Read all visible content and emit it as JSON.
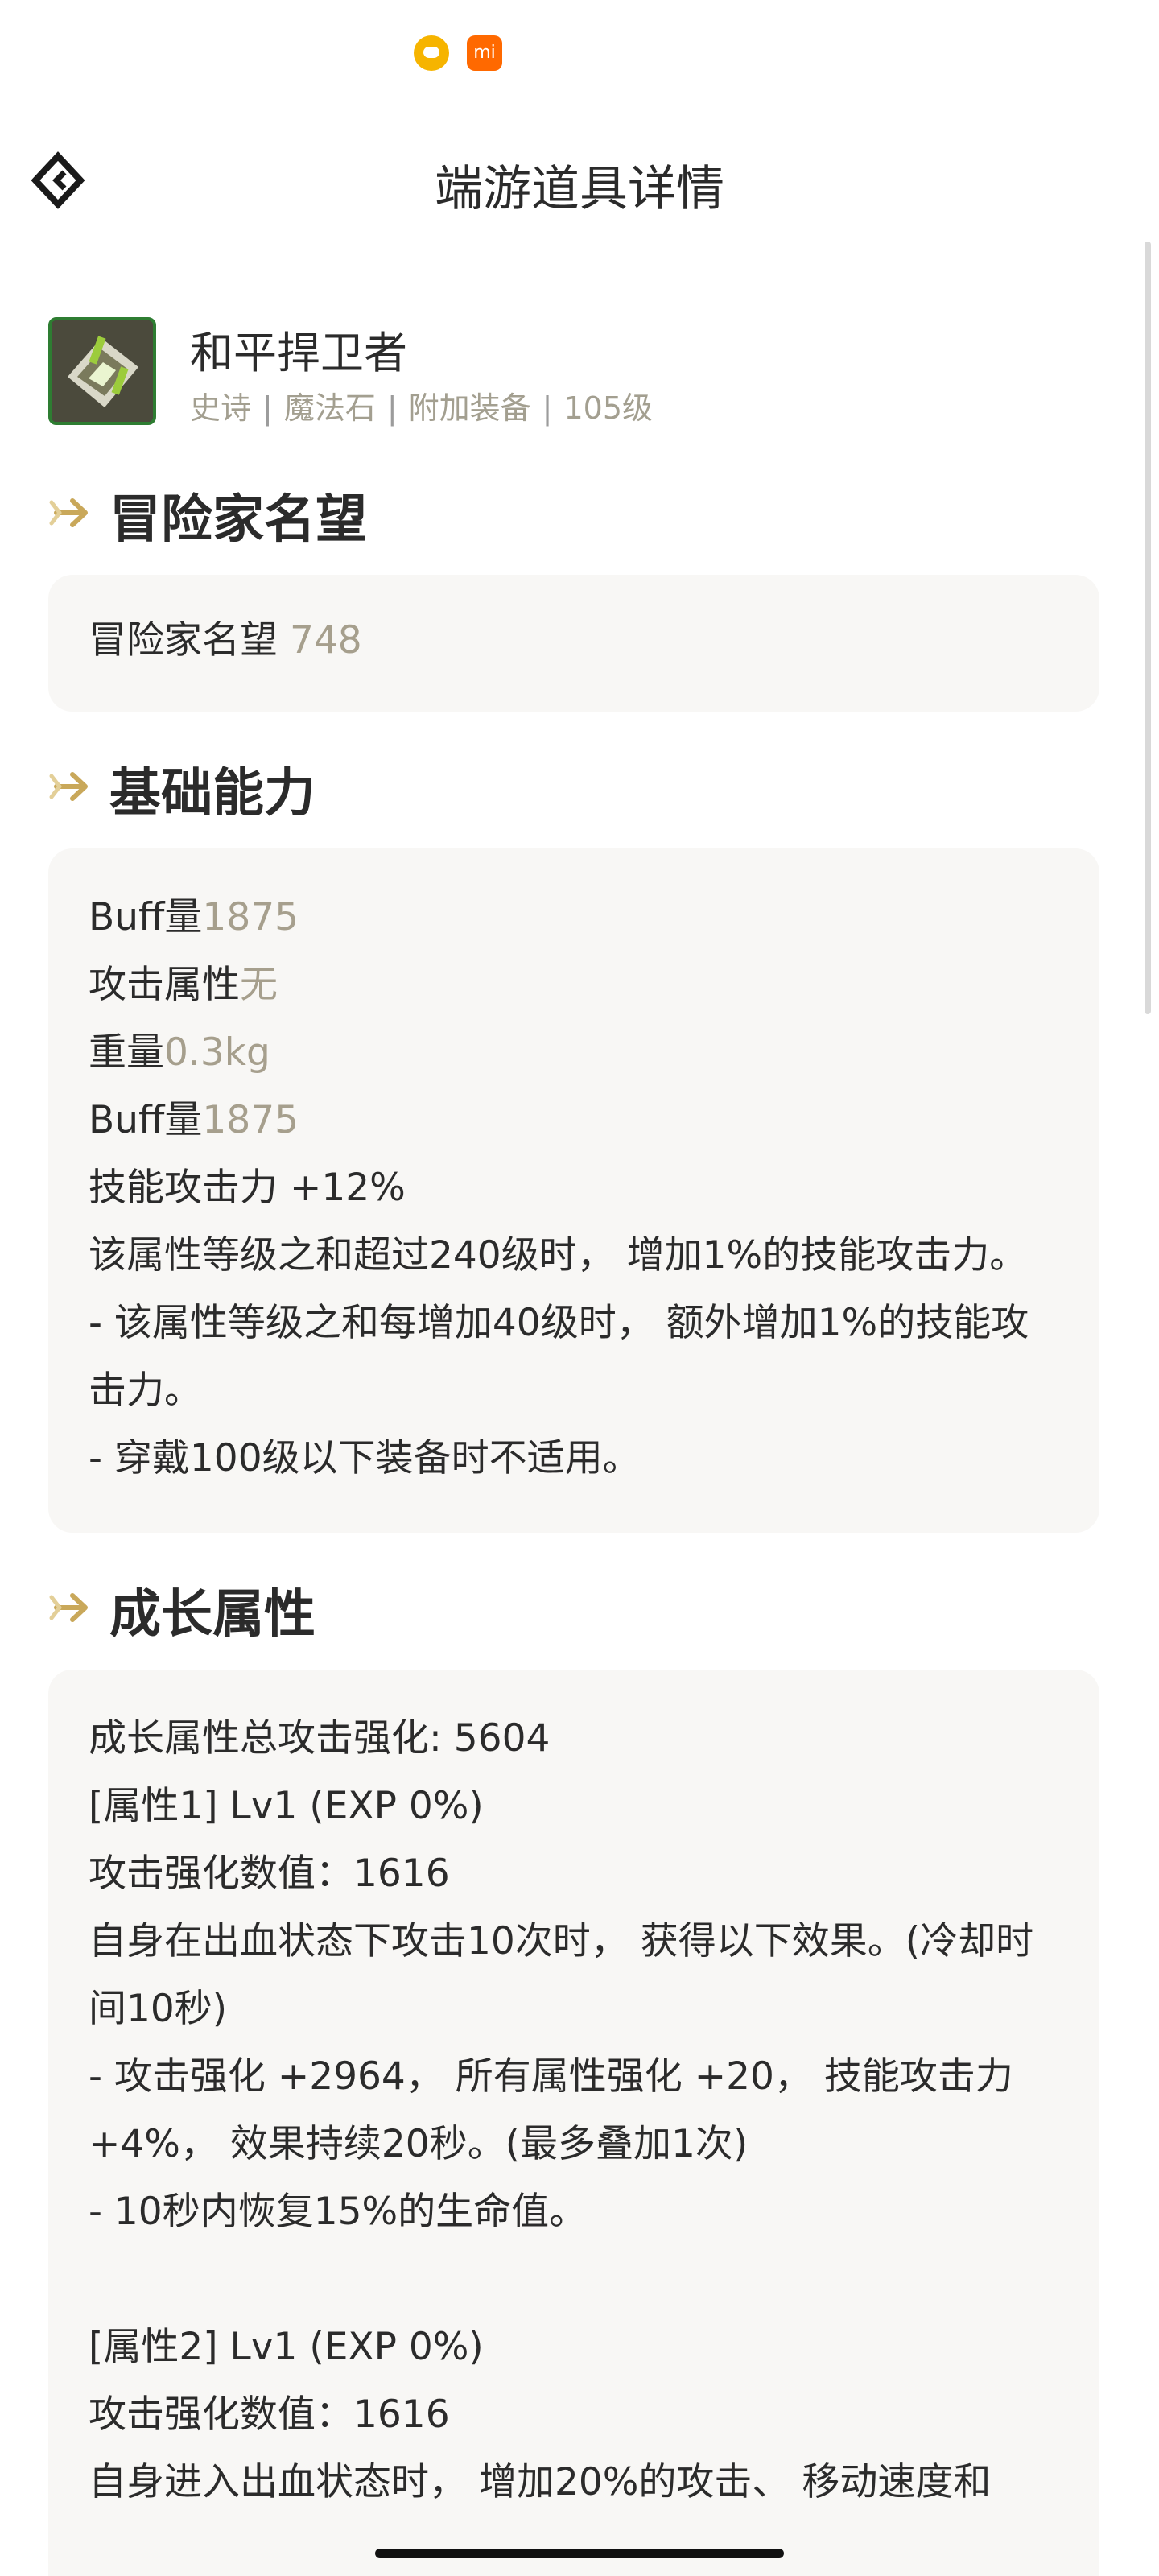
{
  "status": {
    "icons": [
      "bilibili-tv-icon",
      "xiaomi-mi-icon"
    ],
    "mi_label": "mi"
  },
  "nav": {
    "title": "端游道具详情"
  },
  "item": {
    "name": "和平捍卫者",
    "tags": [
      "史诗",
      "魔法石",
      "附加装备",
      "105级"
    ],
    "tag_separator": "|"
  },
  "sections": {
    "reputation": {
      "title": "冒险家名望",
      "label": "冒险家名望",
      "value": "748"
    },
    "base": {
      "title": "基础能力",
      "lines": [
        {
          "label": "Buff量",
          "value": "1875"
        },
        {
          "label": "攻击属性",
          "value": "无"
        },
        {
          "label": "重量",
          "value": "0.3kg"
        },
        {
          "label": "Buff量",
          "value": "1875"
        }
      ],
      "text_lines": [
        "技能攻击力 +12%",
        "该属性等级之和超过240级时， 增加1%的技能攻击力。",
        "- 该属性等级之和每增加40级时， 额外增加1%的技能攻击力。",
        "- 穿戴100级以下装备时不适用。"
      ]
    },
    "growth": {
      "title": "成长属性",
      "lines": [
        "成长属性总攻击强化: 5604",
        "[属性1] Lv1 (EXP 0%)",
        "攻击强化数值：1616",
        "自身在出血状态下攻击10次时， 获得以下效果。(冷却时间10秒)",
        "- 攻击强化 +2964， 所有属性强化 +20， 技能攻击力 +4%， 效果持续20秒。(最多叠加1次)",
        "- 10秒内恢复15%的生命值。",
        "",
        "[属性2] Lv1 (EXP 0%)",
        "攻击强化数值：1616",
        "自身进入出血状态时， 增加20%的攻击、 移动速度和"
      ]
    }
  },
  "colors": {
    "accent_gold": "#c9a85a",
    "muted_text": "#a69f8d",
    "card_bg": "#f8f7f5"
  }
}
